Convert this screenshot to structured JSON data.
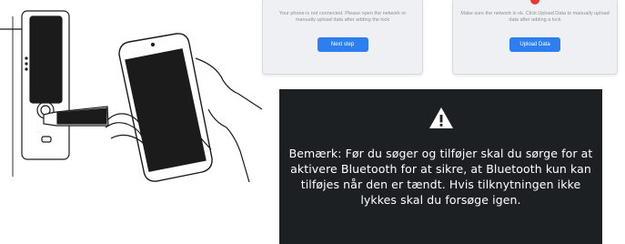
{
  "illustration": {
    "lock_icon": "door-lock-icon",
    "phone_icon": "smartphone-icon",
    "hand_icon": "hand-icon"
  },
  "screens": {
    "not_connected": {
      "message": "Your phone is not connected. Please open the network or manually upload data after adding the lock",
      "button": "Next step"
    },
    "upload": {
      "message": "Make sure the network is ok. Click Upload Data to manually upload data after adding a lock",
      "button": "Upload Data"
    }
  },
  "notice": {
    "icon": "warning-triangle-icon",
    "text": "Bemærk: Før du søger og tilføjer skal du sørge for at aktivere Bluetooth for at sikre, at Bluetooth kun kan tilføjes når den er tændt. Hvis tilknytningen ikke lykkes skal du forsøge igen."
  },
  "colors": {
    "primary_button": "#2d7ff0",
    "notice_background": "#1d2023",
    "alert_red": "#e53935"
  }
}
